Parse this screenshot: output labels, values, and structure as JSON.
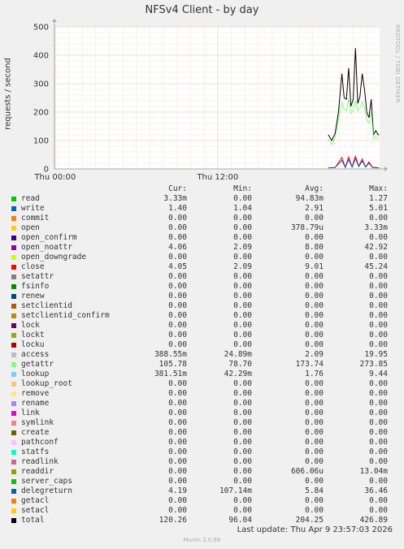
{
  "title": "NFSv4 Client - by day",
  "side_label": "RRDTOOL / TOBI OETIKER",
  "footer": {
    "last_update": "Last update: Thu Apr  9 23:57:03 2026",
    "version": "Munin 2.0.69"
  },
  "columns": {
    "cur": "Cur:",
    "min": "Min:",
    "avg": "Avg:",
    "max": "Max:"
  },
  "legend": [
    {
      "name": "read",
      "color": "#00cc00",
      "cur": "3.33m",
      "min": "0.00",
      "avg": "94.83m",
      "max": "1.27"
    },
    {
      "name": "write",
      "color": "#0066b3",
      "cur": "1.40",
      "min": "1.04",
      "avg": "2.91",
      "max": "5.01"
    },
    {
      "name": "commit",
      "color": "#ff8000",
      "cur": "0.00",
      "min": "0.00",
      "avg": "0.00",
      "max": "0.00"
    },
    {
      "name": "open",
      "color": "#ffcc00",
      "cur": "0.00",
      "min": "0.00",
      "avg": "378.79u",
      "max": "3.33m"
    },
    {
      "name": "open_confirm",
      "color": "#330099",
      "cur": "0.00",
      "min": "0.00",
      "avg": "0.00",
      "max": "0.00"
    },
    {
      "name": "open_noattr",
      "color": "#990099",
      "cur": "4.06",
      "min": "2.09",
      "avg": "8.80",
      "max": "42.92"
    },
    {
      "name": "open_downgrade",
      "color": "#ccff00",
      "cur": "0.00",
      "min": "0.00",
      "avg": "0.00",
      "max": "0.00"
    },
    {
      "name": "close",
      "color": "#ff0000",
      "cur": "4.05",
      "min": "2.09",
      "avg": "9.01",
      "max": "45.24"
    },
    {
      "name": "setattr",
      "color": "#808080",
      "cur": "0.00",
      "min": "0.00",
      "avg": "0.00",
      "max": "0.00"
    },
    {
      "name": "fsinfo",
      "color": "#008f00",
      "cur": "0.00",
      "min": "0.00",
      "avg": "0.00",
      "max": "0.00"
    },
    {
      "name": "renew",
      "color": "#00487d",
      "cur": "0.00",
      "min": "0.00",
      "avg": "0.00",
      "max": "0.00"
    },
    {
      "name": "setclientid",
      "color": "#b35a00",
      "cur": "0.00",
      "min": "0.00",
      "avg": "0.00",
      "max": "0.00"
    },
    {
      "name": "setclientid_confirm",
      "color": "#b38f00",
      "cur": "0.00",
      "min": "0.00",
      "avg": "0.00",
      "max": "0.00"
    },
    {
      "name": "lock",
      "color": "#6b006b",
      "cur": "0.00",
      "min": "0.00",
      "avg": "0.00",
      "max": "0.00"
    },
    {
      "name": "lockt",
      "color": "#8fb300",
      "cur": "0.00",
      "min": "0.00",
      "avg": "0.00",
      "max": "0.00"
    },
    {
      "name": "locku",
      "color": "#b30000",
      "cur": "0.00",
      "min": "0.00",
      "avg": "0.00",
      "max": "0.00"
    },
    {
      "name": "access",
      "color": "#bebebe",
      "cur": "388.55m",
      "min": "24.89m",
      "avg": "2.09",
      "max": "19.95"
    },
    {
      "name": "getattr",
      "color": "#80ff80",
      "cur": "105.78",
      "min": "78.70",
      "avg": "173.74",
      "max": "273.85"
    },
    {
      "name": "lookup",
      "color": "#80c9ff",
      "cur": "381.51m",
      "min": "42.29m",
      "avg": "1.76",
      "max": "9.44"
    },
    {
      "name": "lookup_root",
      "color": "#ffc080",
      "cur": "0.00",
      "min": "0.00",
      "avg": "0.00",
      "max": "0.00"
    },
    {
      "name": "remove",
      "color": "#ffe680",
      "cur": "0.00",
      "min": "0.00",
      "avg": "0.00",
      "max": "0.00"
    },
    {
      "name": "rename",
      "color": "#aa80ff",
      "cur": "0.00",
      "min": "0.00",
      "avg": "0.00",
      "max": "0.00"
    },
    {
      "name": "link",
      "color": "#ee00cc",
      "cur": "0.00",
      "min": "0.00",
      "avg": "0.00",
      "max": "0.00"
    },
    {
      "name": "symlink",
      "color": "#ff8080",
      "cur": "0.00",
      "min": "0.00",
      "avg": "0.00",
      "max": "0.00"
    },
    {
      "name": "create",
      "color": "#666600",
      "cur": "0.00",
      "min": "0.00",
      "avg": "0.00",
      "max": "0.00"
    },
    {
      "name": "pathconf",
      "color": "#ffbfff",
      "cur": "0.00",
      "min": "0.00",
      "avg": "0.00",
      "max": "0.00"
    },
    {
      "name": "statfs",
      "color": "#00ffcc",
      "cur": "0.00",
      "min": "0.00",
      "avg": "0.00",
      "max": "0.00"
    },
    {
      "name": "readlink",
      "color": "#cc6699",
      "cur": "0.00",
      "min": "0.00",
      "avg": "0.00",
      "max": "0.00"
    },
    {
      "name": "readdir",
      "color": "#999900",
      "cur": "0.00",
      "min": "0.00",
      "avg": "606.06u",
      "max": "13.04m"
    },
    {
      "name": "server_caps",
      "color": "#00cc00",
      "cur": "0.00",
      "min": "0.00",
      "avg": "0.00",
      "max": "0.00"
    },
    {
      "name": "delegreturn",
      "color": "#0066b3",
      "cur": "4.19",
      "min": "107.14m",
      "avg": "5.84",
      "max": "36.46"
    },
    {
      "name": "getacl",
      "color": "#ff8000",
      "cur": "0.00",
      "min": "0.00",
      "avg": "0.00",
      "max": "0.00"
    },
    {
      "name": "setacl",
      "color": "#ffcc00",
      "cur": "0.00",
      "min": "0.00",
      "avg": "0.00",
      "max": "0.00"
    },
    {
      "name": "total",
      "color": "#000000",
      "cur": "120.26",
      "min": "96.04",
      "avg": "204.25",
      "max": "426.89"
    }
  ],
  "chart_data": {
    "type": "line",
    "ylabel": "requests / second",
    "ylim": [
      0,
      500
    ],
    "yticks": [
      0,
      100,
      200,
      300,
      400,
      500
    ],
    "xlim": [
      "Wed 23:57",
      "Thu 23:57"
    ],
    "xticks": [
      {
        "label": "Thu 00:00",
        "x": "Thu 00:00"
      },
      {
        "label": "Thu 12:00",
        "x": "Thu 12:00"
      }
    ],
    "grid": true,
    "series": [
      {
        "name": "total",
        "color": "#000000",
        "x": [
          "Thu 20:10",
          "Thu 20:25",
          "Thu 20:40",
          "Thu 20:55",
          "Thu 21:10",
          "Thu 21:20",
          "Thu 21:30",
          "Thu 21:40",
          "Thu 21:50",
          "Thu 22:00",
          "Thu 22:10",
          "Thu 22:20",
          "Thu 22:30",
          "Thu 22:40",
          "Thu 22:50",
          "Thu 23:00",
          "Thu 23:10",
          "Thu 23:20",
          "Thu 23:30",
          "Thu 23:40",
          "Thu 23:50",
          "Thu 23:55"
        ],
        "values": [
          120,
          100,
          125,
          200,
          335,
          250,
          245,
          355,
          220,
          245,
          425,
          230,
          255,
          335,
          280,
          200,
          180,
          245,
          120,
          135,
          120,
          121
        ]
      },
      {
        "name": "getattr",
        "color": "#80ff80",
        "x": [
          "Thu 20:10",
          "Thu 20:25",
          "Thu 20:40",
          "Thu 20:55",
          "Thu 21:10",
          "Thu 21:20",
          "Thu 21:30",
          "Thu 21:40",
          "Thu 21:50",
          "Thu 22:00",
          "Thu 22:10",
          "Thu 22:20",
          "Thu 22:30",
          "Thu 22:40",
          "Thu 22:50",
          "Thu 23:00",
          "Thu 23:10",
          "Thu 23:20",
          "Thu 23:30",
          "Thu 23:40",
          "Thu 23:50",
          "Thu 23:55"
        ],
        "values": [
          105,
          85,
          110,
          175,
          235,
          210,
          205,
          245,
          195,
          210,
          240,
          205,
          215,
          235,
          215,
          175,
          160,
          200,
          105,
          115,
          105,
          106
        ]
      },
      {
        "name": "close",
        "color": "#ff0000",
        "x": [
          "Thu 20:10",
          "Thu 20:40",
          "Thu 21:10",
          "Thu 21:25",
          "Thu 21:40",
          "Thu 21:55",
          "Thu 22:10",
          "Thu 22:25",
          "Thu 22:40",
          "Thu 22:55",
          "Thu 23:10",
          "Thu 23:25",
          "Thu 23:40",
          "Thu 23:55"
        ],
        "values": [
          4,
          5,
          40,
          6,
          42,
          8,
          45,
          10,
          35,
          7,
          25,
          6,
          5,
          4
        ]
      },
      {
        "name": "delegreturn",
        "color": "#0066b3",
        "x": [
          "Thu 20:10",
          "Thu 20:40",
          "Thu 21:10",
          "Thu 21:25",
          "Thu 21:40",
          "Thu 21:55",
          "Thu 22:10",
          "Thu 22:25",
          "Thu 22:40",
          "Thu 22:55",
          "Thu 23:10",
          "Thu 23:25",
          "Thu 23:40",
          "Thu 23:55"
        ],
        "values": [
          4,
          5,
          30,
          5,
          33,
          6,
          36,
          8,
          28,
          6,
          20,
          5,
          4,
          4
        ]
      }
    ]
  }
}
